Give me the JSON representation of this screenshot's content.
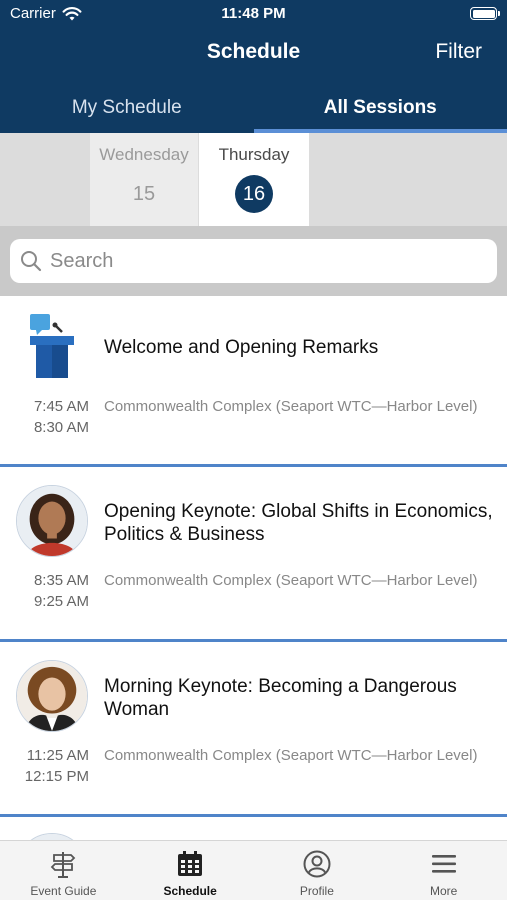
{
  "status_bar": {
    "carrier": "Carrier",
    "time": "11:48 PM"
  },
  "nav": {
    "title": "Schedule",
    "filter_label": "Filter"
  },
  "tabs": [
    {
      "label": "My Schedule",
      "active": false
    },
    {
      "label": "All Sessions",
      "active": true
    }
  ],
  "dates": [
    {
      "day": "Wednesday",
      "num": "15",
      "selected": false
    },
    {
      "day": "Thursday",
      "num": "16",
      "selected": true
    }
  ],
  "search": {
    "placeholder": "Search",
    "value": ""
  },
  "sessions": [
    {
      "title": "Welcome and Opening Remarks",
      "start": "7:45 AM",
      "end": "8:30 AM",
      "location": "Commonwealth Complex (Seaport WTC—Harbor Level)",
      "icon": "podium-icon"
    },
    {
      "title": "Opening Keynote: Global Shifts in Economics, Politics & Business",
      "start": "8:35 AM",
      "end": "9:25 AM",
      "location": "Commonwealth Complex (Seaport WTC—Harbor Level)",
      "icon": "speaker-avatar"
    },
    {
      "title": "Morning Keynote: Becoming a Dangerous Woman",
      "start": "11:25 AM",
      "end": "12:15 PM",
      "location": "Commonwealth Complex (Seaport WTC—Harbor Level)",
      "icon": "speaker-avatar"
    }
  ],
  "bottom_tabs": [
    {
      "label": "Event Guide",
      "icon": "signpost-icon",
      "active": false
    },
    {
      "label": "Schedule",
      "icon": "calendar-icon",
      "active": true
    },
    {
      "label": "Profile",
      "icon": "profile-icon",
      "active": false
    },
    {
      "label": "More",
      "icon": "menu-icon",
      "active": false
    }
  ],
  "colors": {
    "header": "#0f3a62",
    "accent": "#4f84c9",
    "selected_date": "#0f3a62"
  }
}
